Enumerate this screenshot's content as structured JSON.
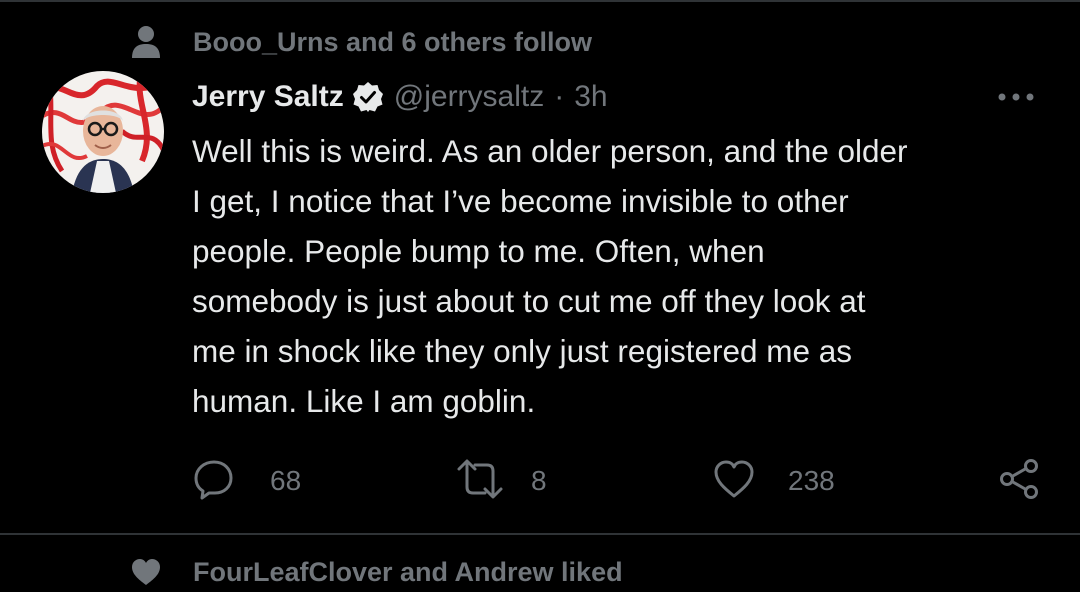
{
  "colors": {
    "background": "#000000",
    "text_primary": "#e7e9ea",
    "text_secondary": "#71767b",
    "divider": "#2f3336",
    "verified_badge": "#e7e9ea"
  },
  "social_context": {
    "icon": "person-icon",
    "text": "Booo_Urns and 6 others follow"
  },
  "tweet": {
    "avatar_icon": "avatar",
    "display_name": "Jerry Saltz",
    "verified_icon": "verified-badge-icon",
    "handle": "@jerrysaltz",
    "separator": "·",
    "timestamp": "3h",
    "more_icon": "more-options-icon",
    "text": "Well this is weird. As an older person, and the older\nI get, I notice that I’ve become invisible to other\npeople. People bump to me. Often, when\nsomebody is just about to cut me off they look at\nme in shock like they only just registered me as\nhuman. Like I am goblin.",
    "actions": {
      "reply": {
        "icon": "reply-icon",
        "count": "68"
      },
      "retweet": {
        "icon": "retweet-icon",
        "count": "8"
      },
      "like": {
        "icon": "heart-icon",
        "count": "238"
      },
      "share": {
        "icon": "share-icon"
      }
    }
  },
  "next_context": {
    "icon": "heart-icon",
    "text": "FourLeafClover and Andrew liked"
  }
}
